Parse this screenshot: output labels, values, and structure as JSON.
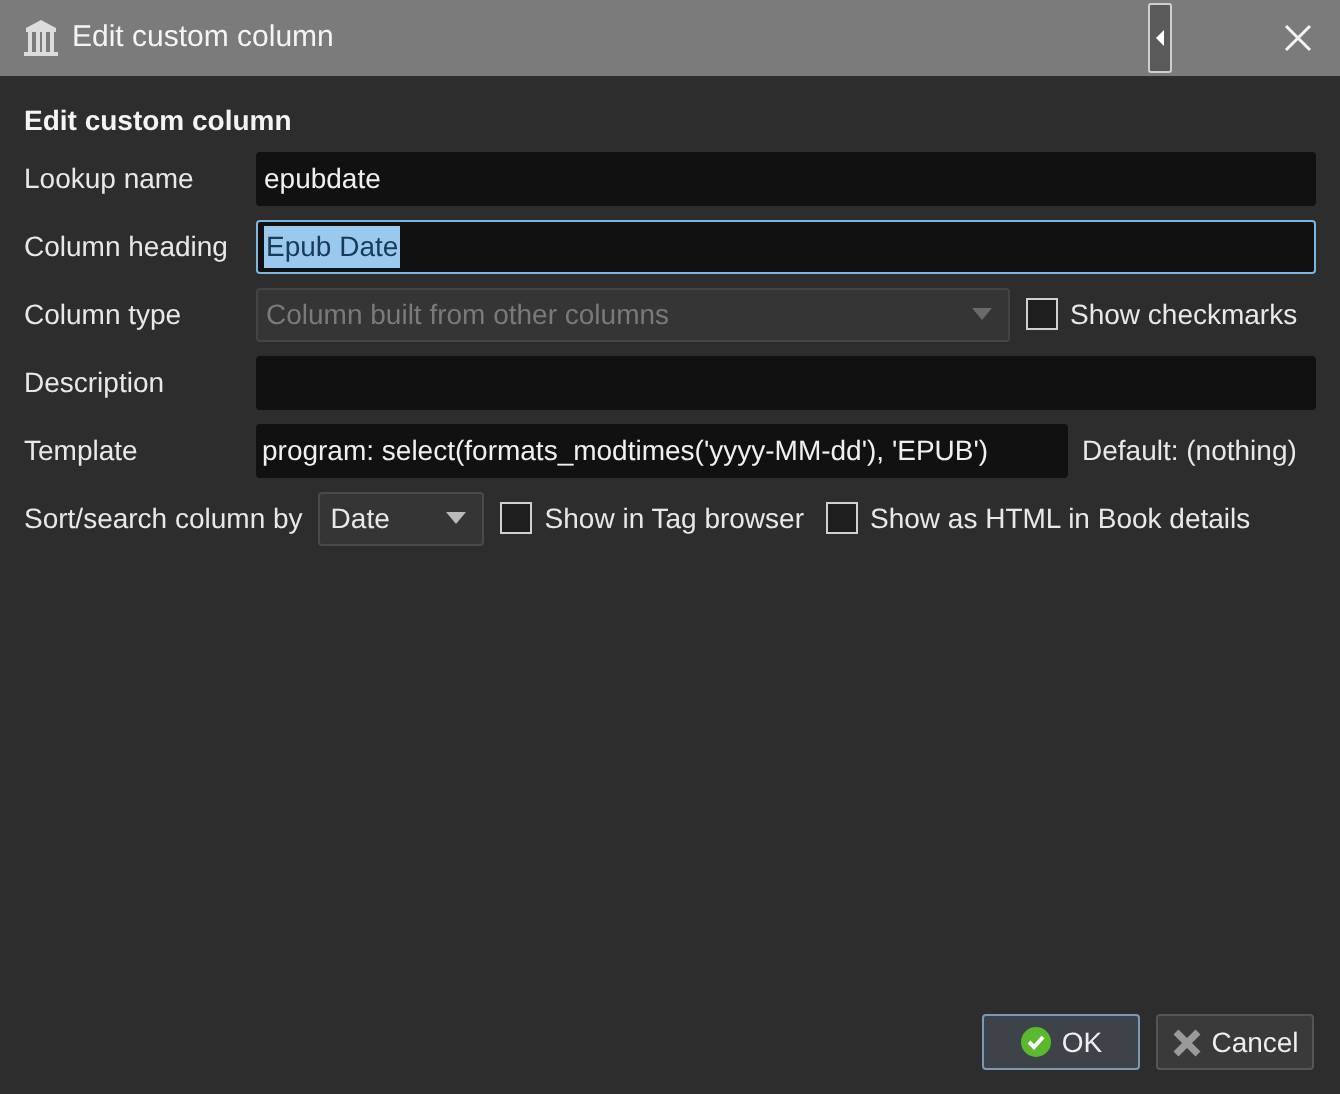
{
  "window": {
    "title": "Edit custom column"
  },
  "heading": "Edit custom column",
  "fields": [
    {
      "kind": "text",
      "label": "Lookup name",
      "value": "epubdate",
      "focused": false
    },
    {
      "kind": "text",
      "label": "Column heading",
      "value": "Epub Date",
      "focused": true
    },
    {
      "kind": "combo",
      "label": "Column type",
      "value": "Column built from other columns",
      "disabled": true,
      "checkbox": {
        "label": "Show checkmarks",
        "checked": false
      }
    },
    {
      "kind": "text",
      "label": "Description",
      "focused": false
    },
    {
      "kind": "template",
      "label": "Template",
      "value": "program: select(formats_modtimes('yyyy-MM-dd'), 'EPUB')",
      "note": "Default: (nothing)"
    }
  ],
  "sort_row": {
    "label": "Sort/search column by",
    "value": "Date",
    "checkboxes": [
      {
        "label": "Show in Tag browser",
        "checked": false
      },
      {
        "label": "Show as HTML in Book details",
        "checked": false
      }
    ]
  },
  "buttons": [
    {
      "label": "OK",
      "kind": "ok",
      "default": true
    },
    {
      "label": "Cancel",
      "kind": "cancel",
      "default": false
    }
  ]
}
